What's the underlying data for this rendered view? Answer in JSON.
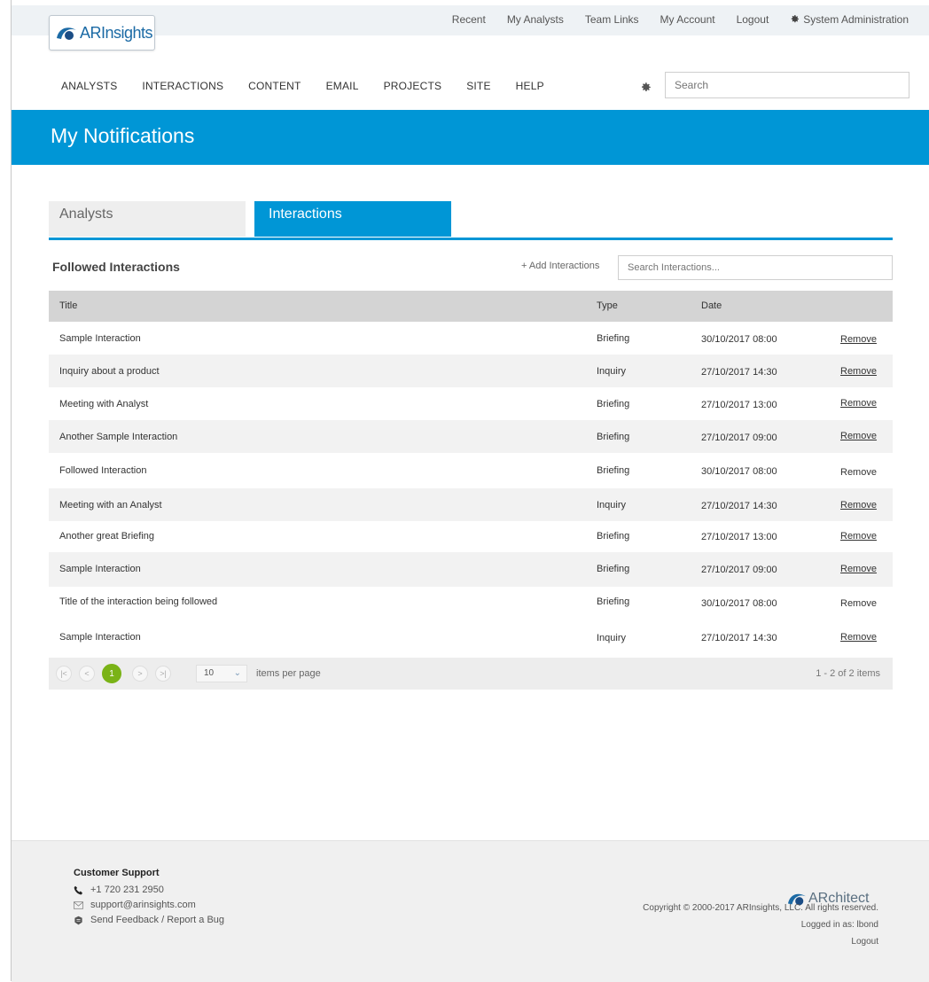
{
  "header": {
    "logo_text": "ARInsights",
    "top_links": [
      "Recent",
      "My Analysts",
      "Team Links",
      "My Account",
      "Logout",
      "System Administration"
    ],
    "nav": [
      "ANALYSTS",
      "INTERACTIONS",
      "CONTENT",
      "EMAIL",
      "PROJECTS",
      "SITE",
      "HELP"
    ],
    "search_placeholder": "Search"
  },
  "page": {
    "title": "My Notifications"
  },
  "tabs": [
    {
      "label": "Analysts",
      "active": false
    },
    {
      "label": "Interactions",
      "active": true
    }
  ],
  "section": {
    "title": "Followed Interactions",
    "add_link": "+ Add Interactions",
    "search_placeholder": "Search Interactions..."
  },
  "table": {
    "columns": [
      "Title",
      "Type",
      "Date"
    ],
    "remove_label": "Remove",
    "rows": [
      {
        "title": "Sample Interaction",
        "type": "Briefing",
        "date": "30/10/2017 08:00"
      },
      {
        "title": "Inquiry about a product",
        "type": "Inquiry",
        "date": "27/10/2017 14:30"
      },
      {
        "title": "Meeting with Analyst",
        "type": "Briefing",
        "date": "27/10/2017 13:00"
      },
      {
        "title": "Another Sample Interaction",
        "type": "Briefing",
        "date": "27/10/2017 09:00"
      },
      {
        "title": "Followed Interaction",
        "type": "Briefing",
        "date": "30/10/2017 08:00"
      },
      {
        "title": "Meeting with an Analyst",
        "type": "Inquiry",
        "date": "27/10/2017 14:30"
      },
      {
        "title": "Another great Briefing",
        "type": "Briefing",
        "date": "27/10/2017 13:00"
      },
      {
        "title": "Sample Interaction",
        "type": "Briefing",
        "date": "27/10/2017 09:00"
      },
      {
        "title": "Title of the interaction being followed",
        "type": "Briefing",
        "date": "30/10/2017 08:00"
      },
      {
        "title": "Sample Interaction",
        "type": "Inquiry",
        "date": "27/10/2017 14:30"
      }
    ]
  },
  "pager": {
    "first": "|<",
    "prev": "<",
    "current": "1",
    "next": ">",
    "last": ">|",
    "per_page": "10",
    "per_page_label": "items per page",
    "info": "1 - 2 of 2 items"
  },
  "footer": {
    "support_title": "Customer Support",
    "phone": "+1 720 231 2950",
    "email": "support@arinsights.com",
    "feedback": "Send Feedback / Report a Bug",
    "logo_text": "ARchitect",
    "copyright": "Copyright © 2000-2017 ARInsights, LLC. All rights reserved.",
    "logged_in": "Logged in as: lbond",
    "logout": "Logout"
  },
  "colors": {
    "brand_blue": "#0096d6",
    "pager_active": "#7ab317"
  }
}
